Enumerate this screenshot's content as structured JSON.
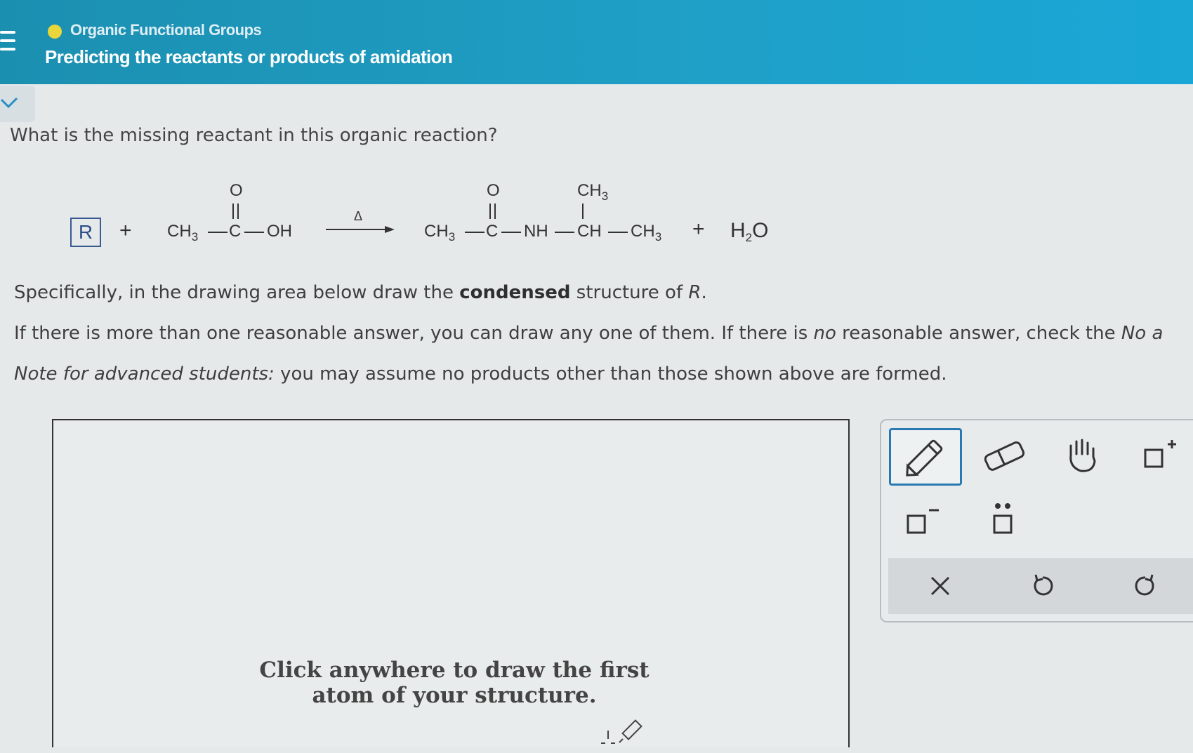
{
  "header": {
    "topic": "Organic Functional Groups",
    "title": "Predicting the reactants or products of amidation"
  },
  "question": "What is the missing reactant in this organic reaction?",
  "reaction": {
    "unknown": "R",
    "plus": "+",
    "acid_ch3": "CH3",
    "acid_c": "C",
    "acid_oh": "OH",
    "o_top": "O",
    "arrow_label": "Δ",
    "prod_ch3": "CH3",
    "prod_c": "C",
    "prod_nh": "NH",
    "prod_ch": "CH",
    "prod_branch_ch3": "CH3",
    "prod_end_ch3": "CH3",
    "water": "H2O"
  },
  "instructions": {
    "line1_a": "Specifically, in the drawing area below draw the ",
    "line1_b": "condensed",
    "line1_c": " structure of ",
    "line1_d": "R",
    "line1_e": ".",
    "line2_a": "If there is more than one reasonable answer, you can draw any one of them. If there is ",
    "line2_b": "no",
    "line2_c": " reasonable answer, check the ",
    "line2_d": "No a",
    "line3_a": "Note for advanced students:",
    "line3_b": " you may assume no products other than those shown above are formed."
  },
  "canvas": {
    "hint_line1": "Click anywhere to draw the first",
    "hint_line2": "atom of your structure."
  },
  "toolbar": {
    "tools": [
      "pencil-icon",
      "eraser-icon",
      "hand-icon",
      "add-charge-plus-icon",
      "add-charge-minus-icon",
      "lone-pair-icon"
    ],
    "actions": [
      "clear-icon",
      "undo-icon",
      "redo-icon"
    ],
    "selected_tool": "pencil-icon",
    "accent_color": "#2a79b2"
  }
}
